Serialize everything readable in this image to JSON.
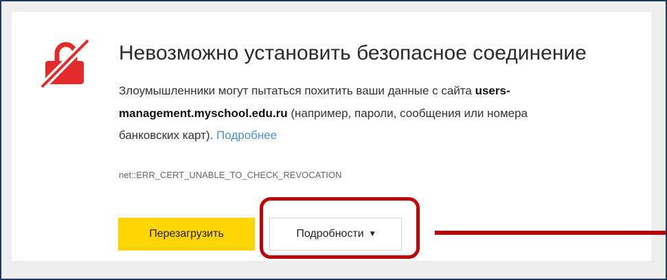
{
  "colors": {
    "frame": "#1f3864",
    "page_bg": "#eeeeee",
    "panel_bg": "#ffffff",
    "icon_red": "#e32b2b",
    "link": "#4a90d9",
    "reload_button_bg": "#ffd400",
    "annotation_red": "#c00000"
  },
  "icons": {
    "error": "crossed-padlock-icon",
    "details_caret": "caret-down-icon"
  },
  "error_page": {
    "title": "Невозможно установить безопасное соединение",
    "description": {
      "text_before": "Злоумышленники могут пытаться похитить ваши данные с сайта ",
      "host": "users-management.myschool.edu.ru",
      "text_after": " (например, пароли, сообщения или номера банковских карт). ",
      "link": "Подробнее"
    },
    "error_code": "net::ERR_CERT_UNABLE_TO_CHECK_REVOCATION"
  },
  "buttons": {
    "reload_label": "Перезагрузить",
    "details_label": "Подробности",
    "details_caret": "▼"
  }
}
